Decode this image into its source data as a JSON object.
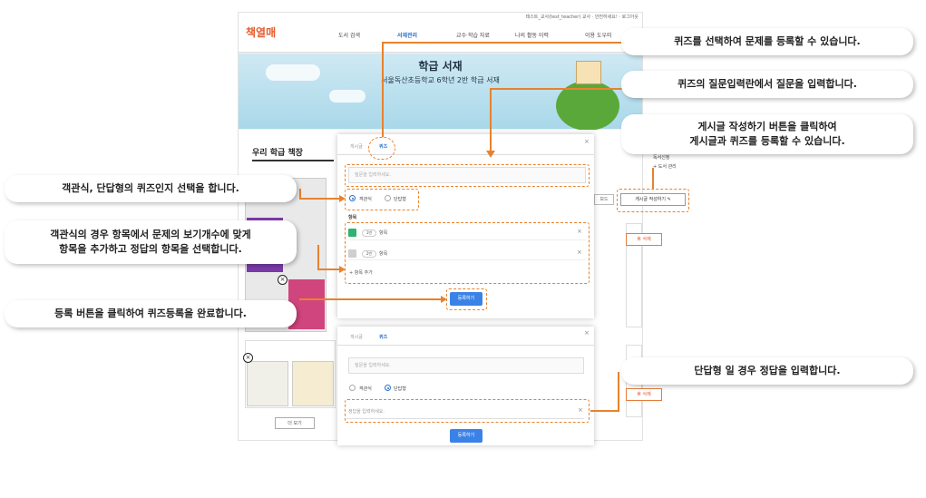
{
  "site": {
    "topbar_text": "테스트_교사(test_teacher) 교사 · 안전하세요! · 로그아웃",
    "logo": "책열매",
    "nav": [
      "도서 검색",
      "서재관리",
      "교수·학습 자료",
      "나의 활동 이력",
      "이용 도우미"
    ],
    "hero_title": "학급 서재",
    "hero_subtitle": "서울독산초등학교 6학년 2반 학급 서재",
    "section_title": "우리 학급 책장",
    "write_button": "게시글 작성하기 ✎",
    "delete_label": "휴 삭제",
    "more_button": "더 보기",
    "side_text_1": "독서신청",
    "side_text_2": "+ 도서 관리",
    "grey_button": "보드"
  },
  "modal_top": {
    "tabs": [
      "게시글",
      "퀴즈"
    ],
    "close": "×",
    "question_placeholder": "질문을 입력하세요.",
    "radio_options": [
      "객관식",
      "단답형"
    ],
    "selected_radio": 0,
    "items_label": "항목",
    "items": [
      {
        "tag": "1번",
        "text": "항목",
        "correct": true
      },
      {
        "tag": "2번",
        "text": "항목",
        "correct": false
      }
    ],
    "add_item": "+ 항목 추가",
    "submit": "등록하기",
    "colors": {
      "correct": "#2fb36e",
      "unchecked": "#cfcfcf",
      "primary": "#3b82e6"
    }
  },
  "modal_bottom": {
    "tabs": [
      "게시글",
      "퀴즈"
    ],
    "close": "×",
    "question_placeholder": "질문을 입력하세요.",
    "radio_options": [
      "객관식",
      "단답형"
    ],
    "selected_radio": 1,
    "answer_placeholder": "정답을 입력하세요.",
    "submit": "등록하기"
  },
  "callouts": {
    "select_quiz": "퀴즈를 선택하여 문제를 등록할 수 있습니다.",
    "question_input": "퀴즈의 질문입력란에서 질문을 입력합니다.",
    "write_post": "게시글 작성하기 버튼을 클릭하여\n게시글과 퀴즈를 등록할 수 있습니다.",
    "type_select": "객관식, 단답형의 퀴즈인지 선택을 합니다.",
    "choice_items": "객관식의 경우 항목에서 문제의 보기개수에 맞게\n항목을 추가하고 정답의 항목을 선택합니다.",
    "submit_click": "등록 버튼을 클릭하여 퀴즈등록을 완료합니다.",
    "short_answer": "단답형 일 경우 정답을 입력합니다."
  },
  "accent_color": "#e8822e"
}
